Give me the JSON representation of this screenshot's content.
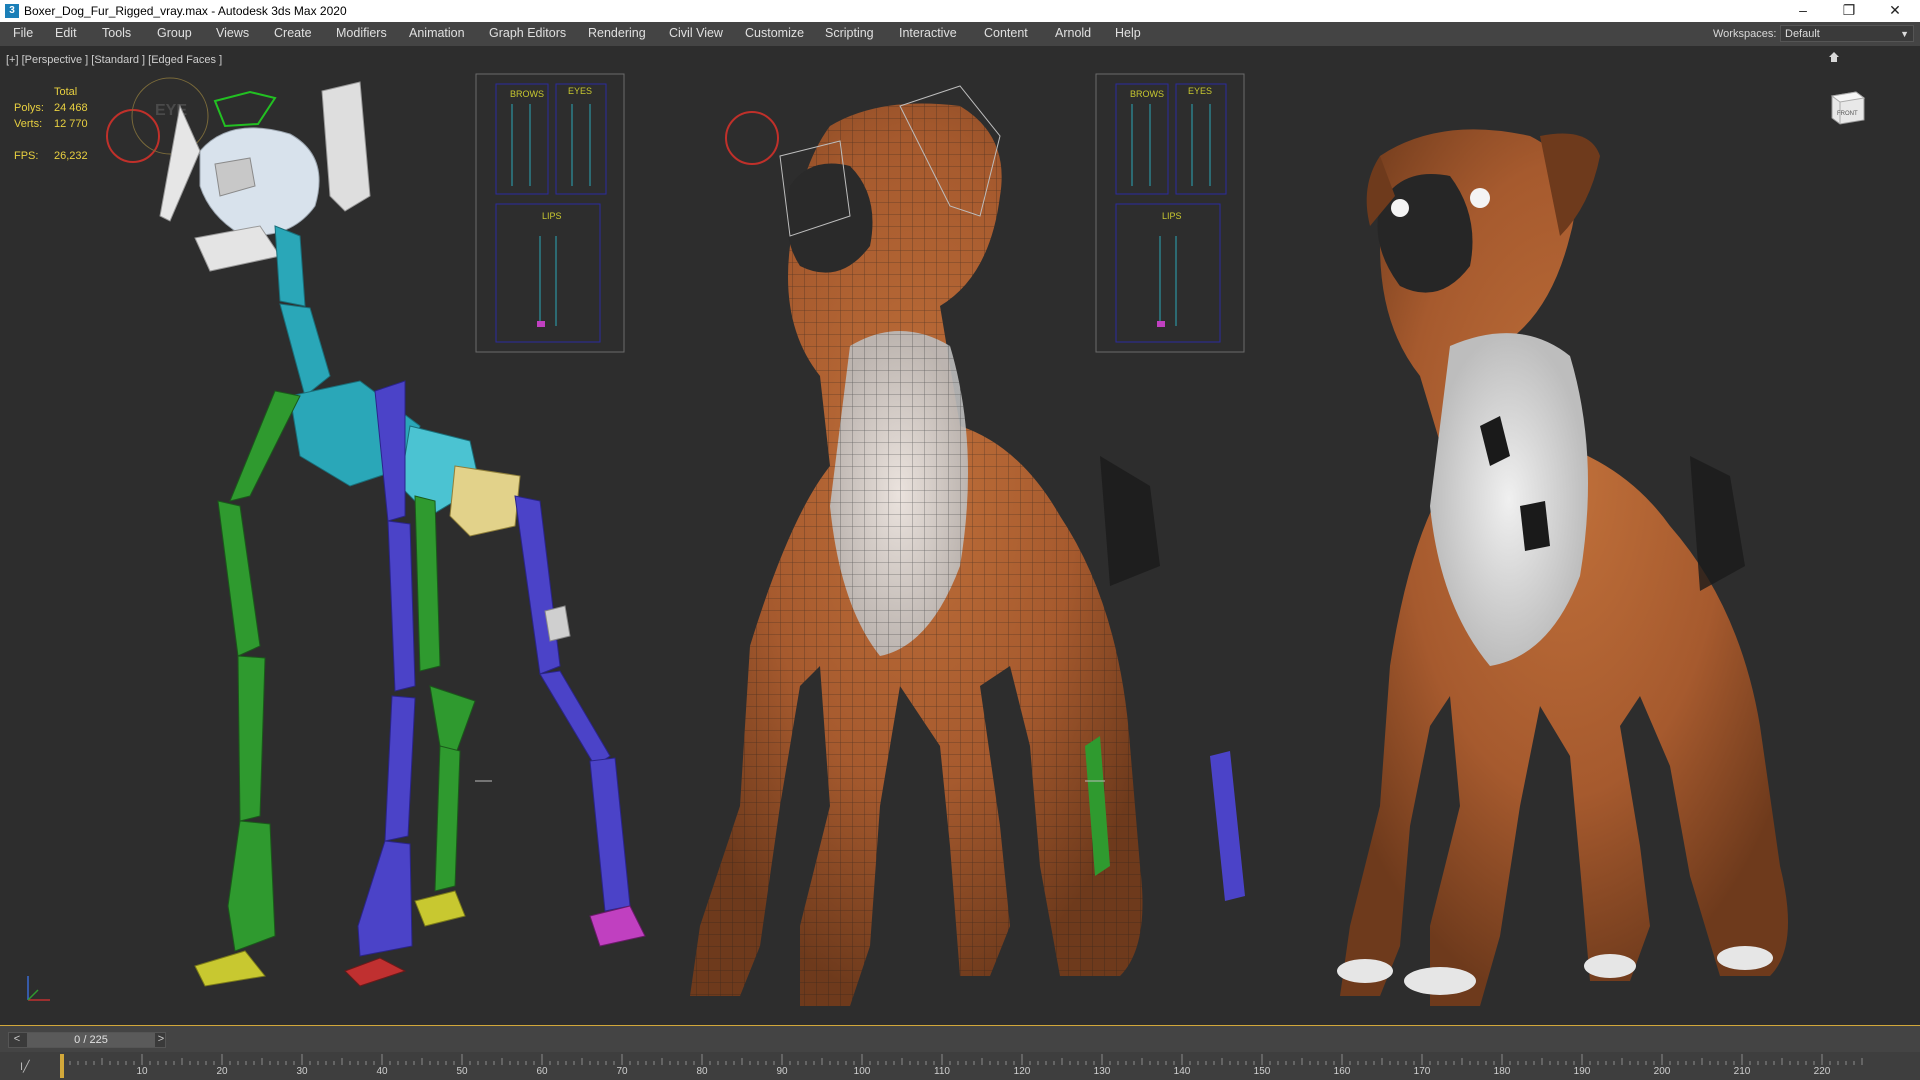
{
  "window": {
    "title": "Boxer_Dog_Fur_Rigged_vray.max - Autodesk 3ds Max 2020",
    "app_icon": "3",
    "minimize_glyph": "–",
    "restore_glyph": "❐",
    "close_glyph": "✕"
  },
  "menu": {
    "items": [
      {
        "label": "File"
      },
      {
        "label": "Edit"
      },
      {
        "label": "Tools"
      },
      {
        "label": "Group"
      },
      {
        "label": "Views"
      },
      {
        "label": "Create"
      },
      {
        "label": "Modifiers"
      },
      {
        "label": "Animation"
      },
      {
        "label": "Graph Editors"
      },
      {
        "label": "Rendering"
      },
      {
        "label": "Civil View"
      },
      {
        "label": "Customize"
      },
      {
        "label": "Scripting"
      },
      {
        "label": "Interactive"
      },
      {
        "label": "Content"
      },
      {
        "label": "Arnold"
      },
      {
        "label": "Help"
      }
    ],
    "workspaces_label": "Workspaces:",
    "workspaces_value": "Default"
  },
  "viewport": {
    "label": "[+] [Perspective ] [Standard ] [Edged Faces ]",
    "stats": {
      "header": "Total",
      "polys_label": "Polys:",
      "polys_value": "24 468",
      "verts_label": "Verts:",
      "verts_value": "12 770",
      "fps_label": "FPS:",
      "fps_value": "26,232"
    },
    "panel_labels": {
      "brows": "BROWS",
      "eyes": "EYES",
      "lips": "LIPS",
      "eye_gizmo": "EYE"
    },
    "viewcube_label": "FRONT"
  },
  "timeline": {
    "frame_display": "0 / 225",
    "prev_glyph": "<",
    "next_glyph": ">",
    "track_icon": "I╱",
    "ticks": [
      "10",
      "20",
      "30",
      "40",
      "50",
      "60",
      "70",
      "80",
      "90",
      "100",
      "110",
      "120",
      "130",
      "140",
      "150",
      "160",
      "170",
      "180",
      "190",
      "200",
      "210",
      "220"
    ]
  },
  "colors": {
    "accent_timeline": "#d2a83a",
    "rig_left": "#2f9a2f",
    "rig_right": "#4b43c8",
    "rig_spine": "#2aa7b8",
    "fur_base": "#a65a2e"
  }
}
